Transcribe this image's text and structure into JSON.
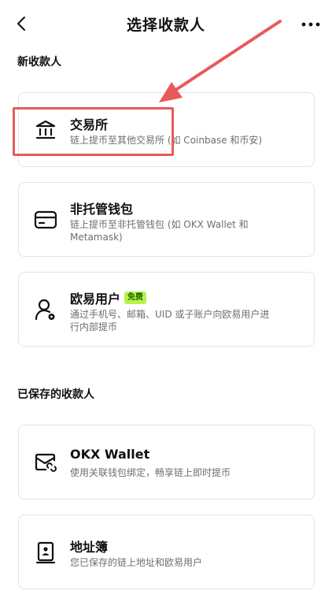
{
  "header": {
    "title": "选择收款人"
  },
  "sections": {
    "new": "新收款人",
    "saved": "已保存的收款人"
  },
  "new_payees": [
    {
      "title": "交易所",
      "desc": "链上提币至其他交易所 (如 Coinbase 和币安)"
    },
    {
      "title": "非托管钱包",
      "desc": "链上提币至非托管钱包 (如 OKX Wallet 和 Metamask)"
    },
    {
      "title": "欧易用户",
      "badge": "免费",
      "desc": "通过手机号、邮箱、UID 或子账户向欧易用户进行内部提币"
    }
  ],
  "saved_payees": [
    {
      "title": "OKX Wallet",
      "desc": "使用关联钱包绑定，畅享链上即时提币"
    },
    {
      "title": "地址簿",
      "desc": "您已保存的链上地址和欧易用户"
    }
  ],
  "colors": {
    "highlight": "#e85a5a",
    "badge_bg": "#b8f24a",
    "badge_text": "#1d6b00"
  }
}
